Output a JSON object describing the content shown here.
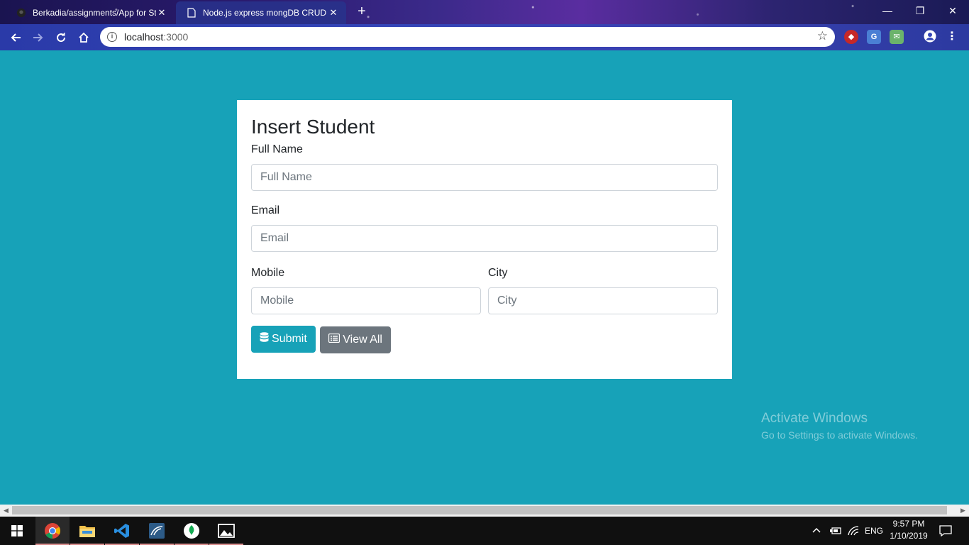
{
  "browser": {
    "tabs": [
      {
        "title": "Berkadia/assignments/App for St",
        "close": "✕"
      },
      {
        "title": "Node.js express mongDB CRUD",
        "close": "✕"
      }
    ],
    "new_tab": "+",
    "window_controls": {
      "minimize": "—",
      "restore": "❐",
      "close": "✕"
    },
    "address": {
      "host": "localhost",
      "port": ":3000"
    }
  },
  "page": {
    "heading": "Insert Student",
    "full_name": {
      "label": "Full Name",
      "placeholder": "Full Name"
    },
    "email": {
      "label": "Email",
      "placeholder": "Email"
    },
    "mobile": {
      "label": "Mobile",
      "placeholder": "Mobile"
    },
    "city": {
      "label": "City",
      "placeholder": "City"
    },
    "submit_label": "Submit",
    "view_all_label": "View All"
  },
  "watermark": {
    "title": "Activate Windows",
    "subtitle": "Go to Settings to activate Windows."
  },
  "taskbar": {
    "language": "ENG",
    "time": "9:57 PM",
    "date": "1/10/2019"
  },
  "colors": {
    "page_bg": "#17a2b8",
    "submit": "#17a2b8",
    "view_all": "#6c757d"
  }
}
